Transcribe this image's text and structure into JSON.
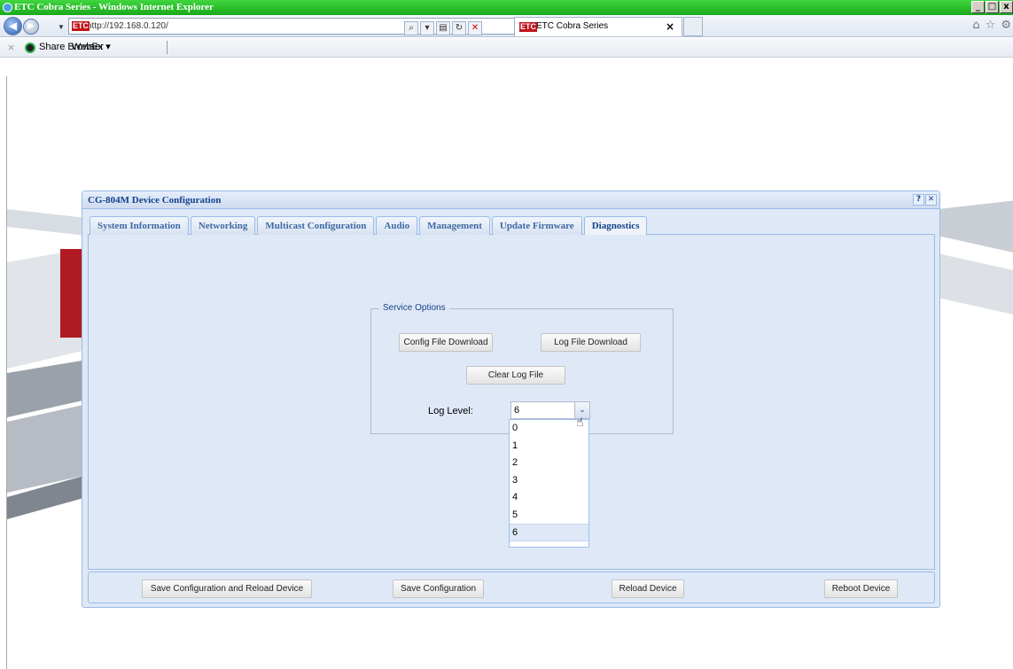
{
  "window": {
    "title": "ETC Cobra Series - Windows Internet Explorer"
  },
  "browser": {
    "url": "http://192.168.0.120/",
    "tab_title": "ETC Cobra Series",
    "logo_text": "ETC",
    "favorites": {
      "share_browser": "Share Browser",
      "webex": "WebEx ▾"
    }
  },
  "dialog": {
    "title": "CG-804M Device Configuration",
    "help_label": "?",
    "close_label": "✕",
    "tabs": [
      {
        "label": "System Information"
      },
      {
        "label": "Networking"
      },
      {
        "label": "Multicast Configuration"
      },
      {
        "label": "Audio"
      },
      {
        "label": "Management"
      },
      {
        "label": "Update Firmware"
      },
      {
        "label": "Diagnostics"
      }
    ],
    "active_tab": "Diagnostics",
    "service_options": {
      "legend": "Service Options",
      "config_download": "Config File Download",
      "log_download": "Log File Download",
      "clear_log": "Clear Log File",
      "log_level_label": "Log Level:",
      "log_level_value": "6",
      "log_level_options": [
        "0",
        "1",
        "2",
        "3",
        "4",
        "5",
        "6"
      ]
    },
    "footer": {
      "save_reload": "Save Configuration and Reload Device",
      "save": "Save Configuration",
      "reload": "Reload Device",
      "reboot": "Reboot Device"
    }
  }
}
